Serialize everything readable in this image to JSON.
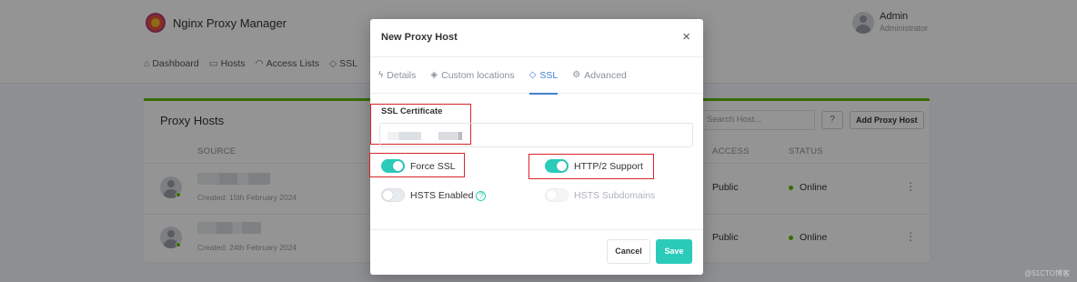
{
  "app": {
    "brand_name": "Nginx Proxy Manager",
    "user_name": "Admin",
    "user_role": "Administrator",
    "nav": [
      {
        "label": "Dashboard",
        "icon": "home-icon"
      },
      {
        "label": "Hosts",
        "icon": "monitor-icon"
      },
      {
        "label": "Access Lists",
        "icon": "lock-icon"
      },
      {
        "label": "SSL",
        "icon": "shield-icon"
      }
    ]
  },
  "card": {
    "title": "Proxy Hosts",
    "search_placeholder": "Search Host...",
    "help_label": "?",
    "add_label": "Add Proxy Host",
    "columns": {
      "source": "SOURCE",
      "access": "ACCESS",
      "status": "STATUS"
    },
    "rows": [
      {
        "created": "Created: 15th February 2024",
        "access": "Public",
        "status": "Online"
      },
      {
        "created": "Created: 24th February 2024",
        "access": "Public",
        "status": "Online"
      }
    ]
  },
  "modal": {
    "title": "New Proxy Host",
    "close": "×",
    "tabs": [
      {
        "label": "Details",
        "icon": "zap-icon"
      },
      {
        "label": "Custom locations",
        "icon": "layers-icon"
      },
      {
        "label": "SSL",
        "icon": "shield-icon"
      },
      {
        "label": "Advanced",
        "icon": "gear-icon"
      }
    ],
    "ssl_certificate_label": "SSL Certificate",
    "toggles": {
      "force_ssl": {
        "label": "Force SSL",
        "on": true
      },
      "http2": {
        "label": "HTTP/2 Support",
        "on": true
      },
      "hsts": {
        "label": "HSTS Enabled",
        "on": false
      },
      "hsts_sub": {
        "label": "HSTS Subdomains",
        "on": false
      }
    },
    "cancel_label": "Cancel",
    "save_label": "Save"
  },
  "watermark": "@51CTO博客"
}
